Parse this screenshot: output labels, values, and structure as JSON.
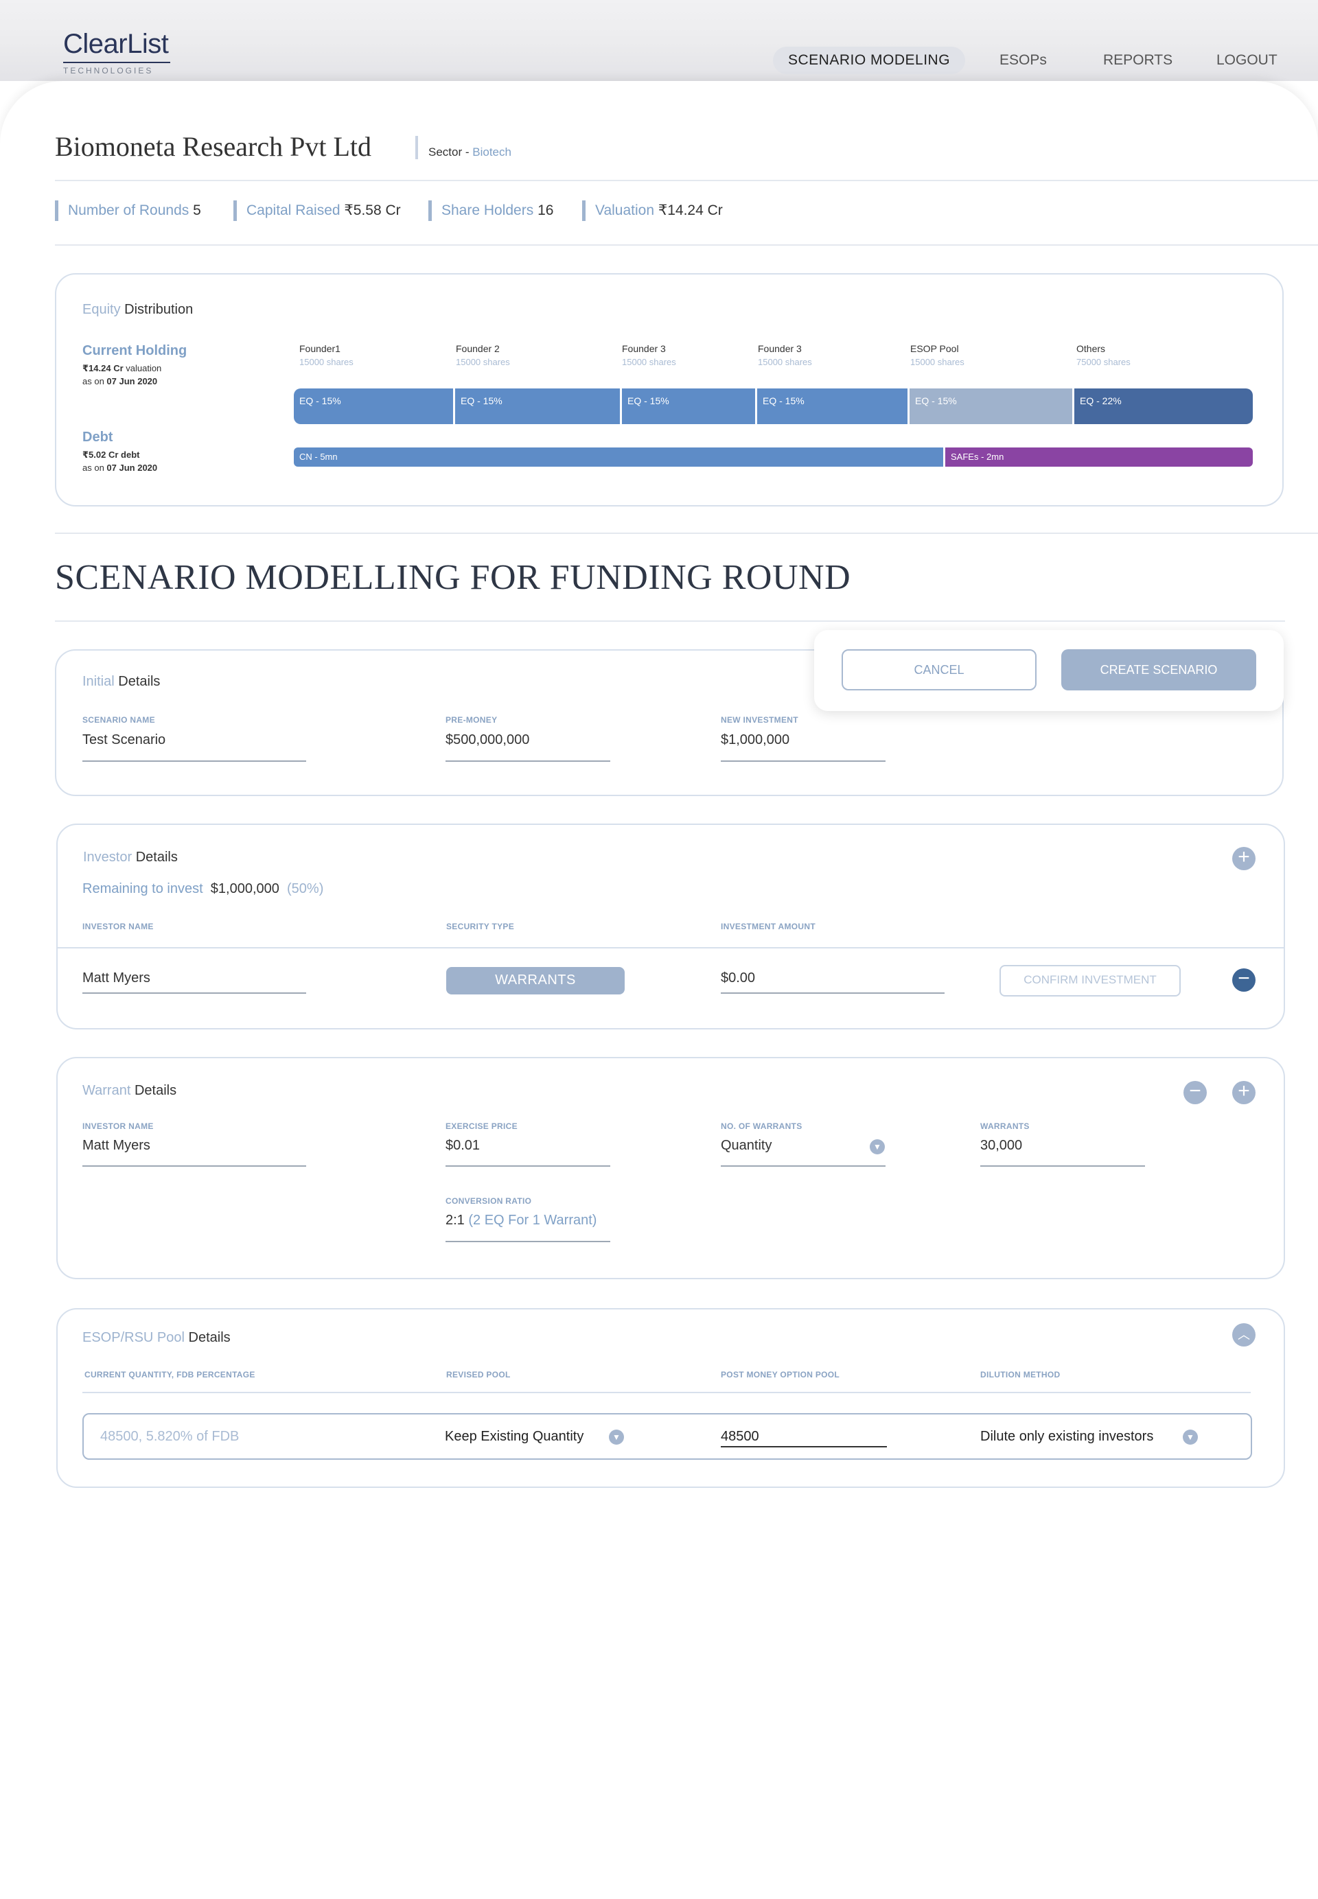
{
  "brand": {
    "name": "ClearList",
    "sub": "TECHNOLOGIES"
  },
  "nav": [
    {
      "label": "SCENARIO MODELING"
    },
    {
      "label": "ESOPs"
    },
    {
      "label": "REPORTS"
    },
    {
      "label": "LOGOUT"
    }
  ],
  "company": {
    "name": "Biomoneta Research Pvt Ltd",
    "sector_label": "Sector - ",
    "sector_value": "Biotech"
  },
  "stats": [
    {
      "label": "Number of Rounds",
      "value": "5"
    },
    {
      "label": "Capital Raised",
      "value": "₹5.58 Cr"
    },
    {
      "label": "Share Holders",
      "value": "16"
    },
    {
      "label": "Valuation",
      "value": "₹14.24 Cr"
    }
  ],
  "equity": {
    "title_accent": "Equity",
    "title_rest": " Distribution",
    "current": {
      "title": "Current Holding",
      "val": "₹14.24 Cr",
      "val_suffix": " valuation",
      "asof": "as on ",
      "date": "07 Jun 2020"
    },
    "holders": [
      {
        "name": "Founder1",
        "shares": "15000 shares",
        "bar_label": "EQ - 15%",
        "color": "#5e8cc7"
      },
      {
        "name": "Founder 2",
        "shares": "15000 shares",
        "bar_label": "EQ - 15%",
        "color": "#5e8cc7"
      },
      {
        "name": "Founder 3",
        "shares": "15000 shares",
        "bar_label": "EQ - 15%",
        "color": "#5e8cc7"
      },
      {
        "name": "Founder 3",
        "shares": "15000 shares",
        "bar_label": "EQ - 15%",
        "color": "#5e8cc7"
      },
      {
        "name": "ESOP Pool",
        "shares": "15000 shares",
        "bar_label": "EQ - 15%",
        "color": "#9fb2cc"
      },
      {
        "name": "Others",
        "shares": "75000 shares",
        "bar_label": "EQ - 22%",
        "color": "#46699f"
      }
    ],
    "debt": {
      "title": "Debt",
      "val": "₹5.02 Cr debt",
      "asof": "as on ",
      "date": "07 Jun 2020",
      "segments": [
        {
          "label": "CN - 5mn",
          "color": "#5e8cc7"
        },
        {
          "label": "SAFEs - 2mn",
          "color": "#8a44a3"
        }
      ]
    }
  },
  "scenario": {
    "heading": "SCENARIO MODELLING FOR FUNDING ROUND",
    "cancel": "CANCEL",
    "create": "CREATE SCENARIO",
    "initial": {
      "accent": "Initial",
      "rest": " Details",
      "name_label": "SCENARIO NAME",
      "name_value": "Test Scenario",
      "pre_label": "PRE-MONEY",
      "pre_value": "$500,000,000",
      "inv_label": "NEW INVESTMENT",
      "inv_value": "$1,000,000"
    },
    "investor": {
      "accent": "Investor",
      "rest": " Details",
      "remaining_label": "Remaining to invest",
      "remaining_value": "$1,000,000",
      "remaining_pct": "(50%)",
      "col_name": "INVESTOR NAME",
      "col_type": "SECURITY TYPE",
      "col_amount": "INVESTMENT AMOUNT",
      "row": {
        "name": "Matt Myers",
        "type": "WARRANTS",
        "amount": "$0.00",
        "confirm": "CONFIRM INVESTMENT"
      }
    },
    "warrant": {
      "accent": "Warrant",
      "rest": " Details",
      "name_label": "INVESTOR NAME",
      "name_value": "Matt Myers",
      "price_label": "EXERCISE PRICE",
      "price_value": "$0.01",
      "num_label": "NO. OF WARRANTS",
      "num_value": "Quantity",
      "warr_label": "WARRANTS",
      "warr_value": "30,000",
      "ratio_label": "CONVERSION RATIO",
      "ratio_value": "2:1",
      "ratio_hint": "(2 EQ For 1 Warrant)"
    },
    "esop": {
      "accent": "ESOP/RSU Pool",
      "rest": " Details",
      "col_current": "CURRENT QUANTITY, FDB PERCENTAGE",
      "col_revised": "REVISED POOL",
      "col_post": "POST MONEY OPTION POOL",
      "col_dilution": "DILUTION METHOD",
      "current_value": "48500, 5.820% of FDB",
      "revised_value": "Keep Existing Quantity",
      "post_value": "48500",
      "dilution_value": "Dilute only existing investors"
    }
  }
}
